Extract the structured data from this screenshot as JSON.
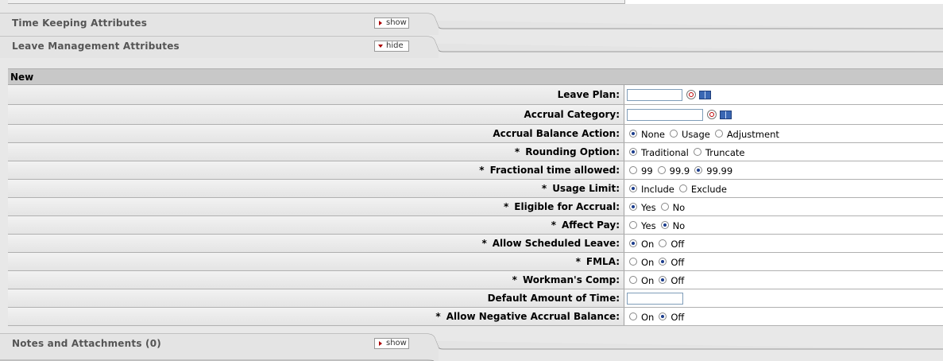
{
  "tabs": {
    "time_keeping": {
      "title": "Time Keeping Attributes",
      "toggle": "show"
    },
    "leave_management": {
      "title": "Leave Management Attributes",
      "toggle": "hide"
    },
    "notes": {
      "title": "Notes and Attachments (0)",
      "toggle": "show"
    }
  },
  "section": {
    "header": "New"
  },
  "fields": {
    "leave_plan": {
      "label": "Leave Plan:",
      "value": ""
    },
    "accrual_category": {
      "label": "Accrual Category:",
      "value": ""
    },
    "accrual_balance_action": {
      "label": "Accrual Balance Action:",
      "options": [
        "None",
        "Usage",
        "Adjustment"
      ],
      "selected": "None"
    },
    "rounding_option": {
      "required": "*",
      "label": "Rounding Option:",
      "options": [
        "Traditional",
        "Truncate"
      ],
      "selected": "Traditional"
    },
    "fractional_time": {
      "required": "*",
      "label": "Fractional time allowed:",
      "options": [
        "99",
        "99.9",
        "99.99"
      ],
      "selected": "99.99"
    },
    "usage_limit": {
      "required": "*",
      "label": "Usage Limit:",
      "options": [
        "Include",
        "Exclude"
      ],
      "selected": "Include"
    },
    "eligible_for_accrual": {
      "required": "*",
      "label": "Eligible for Accrual:",
      "options": [
        "Yes",
        "No"
      ],
      "selected": "Yes"
    },
    "affect_pay": {
      "required": "*",
      "label": "Affect Pay:",
      "options": [
        "Yes",
        "No"
      ],
      "selected": "No"
    },
    "allow_scheduled_leave": {
      "required": "*",
      "label": "Allow Scheduled Leave:",
      "options": [
        "On",
        "Off"
      ],
      "selected": "On"
    },
    "fmla": {
      "required": "*",
      "label": "FMLA:",
      "options": [
        "On",
        "Off"
      ],
      "selected": "Off"
    },
    "workmans_comp": {
      "required": "*",
      "label": "Workman's Comp:",
      "options": [
        "On",
        "Off"
      ],
      "selected": "Off"
    },
    "default_amount": {
      "label": "Default Amount of Time:",
      "value": ""
    },
    "allow_negative": {
      "required": "*",
      "label": "Allow Negative Accrual Balance:",
      "options": [
        "On",
        "Off"
      ],
      "selected": "Off"
    }
  },
  "icons": {
    "lookup": "magnifier-icon",
    "inquiry": "book-icon"
  }
}
